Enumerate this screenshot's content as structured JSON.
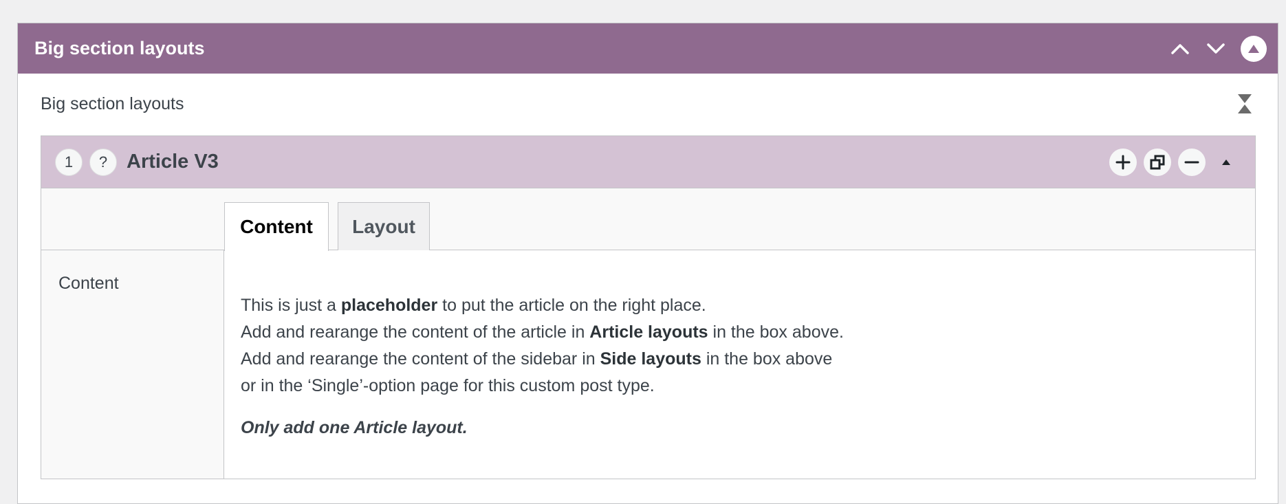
{
  "postbox": {
    "title": "Big section layouts",
    "color": "#8f6a8f"
  },
  "field": {
    "label": "Big section layouts"
  },
  "layout": {
    "order": "1",
    "help": "?",
    "title": "Article V3",
    "handle_color": "#d4c2d4",
    "actions": [
      "add-icon",
      "duplicate-icon",
      "remove-icon",
      "collapse-caret-icon"
    ]
  },
  "tabs": {
    "content": "Content",
    "layout": "Layout"
  },
  "content_field": {
    "label": "Content"
  },
  "message": {
    "line1_a": "This is just a ",
    "line1_b": "placeholder",
    "line1_c": " to put the article on the right place.",
    "line2_a": "Add and rearange the content of the article in ",
    "line2_b": "Article layouts",
    "line2_c": " in the box above.",
    "line3_a": "Add and rearange the content of the sidebar in ",
    "line3_b": "Side layouts",
    "line3_c": " in the box above",
    "line4": "or in the ‘Single’-option page for this custom post type.",
    "note": "Only add one Article layout."
  }
}
